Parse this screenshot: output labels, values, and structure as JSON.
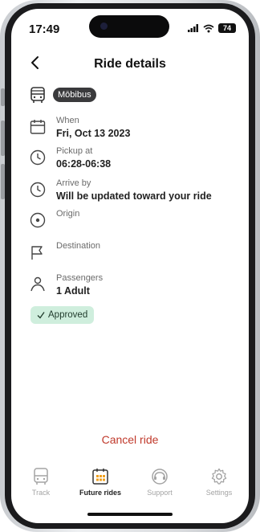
{
  "status": {
    "time": "17:49",
    "battery": "74"
  },
  "header": {
    "title": "Ride details"
  },
  "brand": {
    "name": "Mōbibus"
  },
  "details": [
    {
      "label": "When",
      "value": "Fri, Oct 13 2023",
      "icon": "calendar-icon"
    },
    {
      "label": "Pickup at",
      "value": "06:28-06:38",
      "icon": "clock-icon"
    },
    {
      "label": "Arrive by",
      "value": "Will be updated toward your ride",
      "icon": "clock-icon"
    },
    {
      "label": "Origin",
      "value": "",
      "icon": "location-pin-icon"
    },
    {
      "label": "Destination",
      "value": "",
      "icon": "flag-icon"
    },
    {
      "label": "Passengers",
      "value": "1 Adult",
      "icon": "person-icon"
    }
  ],
  "status_badge": {
    "label": "Approved"
  },
  "actions": {
    "cancel_label": "Cancel ride"
  },
  "tabs": [
    {
      "label": "Track",
      "icon": "bus-icon",
      "active": false
    },
    {
      "label": "Future rides",
      "icon": "calendar-grid-icon",
      "active": true
    },
    {
      "label": "Support",
      "icon": "headset-icon",
      "active": false
    },
    {
      "label": "Settings",
      "icon": "gear-icon",
      "active": false
    }
  ],
  "colors": {
    "accent": "#f0a020",
    "cancel": "#c0392b",
    "approved_bg": "#cfeedd"
  }
}
